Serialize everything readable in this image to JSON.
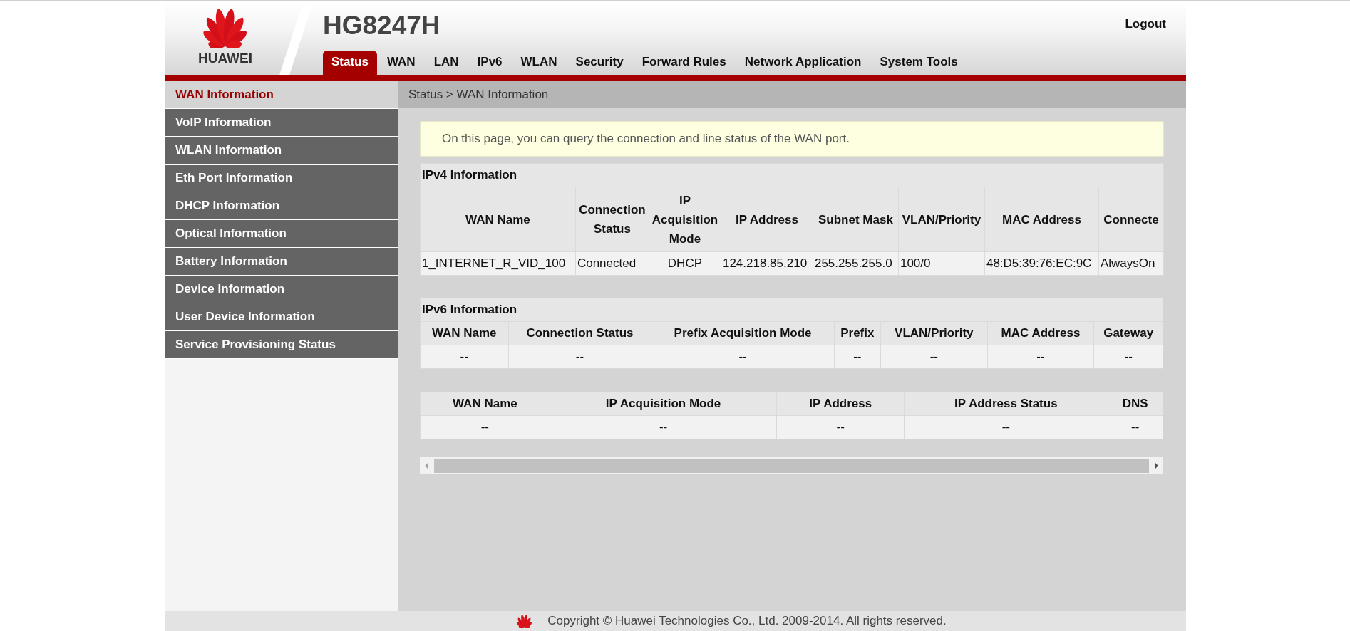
{
  "header": {
    "brand": "HUAWEI",
    "model": "HG8247H",
    "logout": "Logout"
  },
  "tabs": [
    {
      "label": "Status",
      "selected": true
    },
    {
      "label": "WAN",
      "selected": false
    },
    {
      "label": "LAN",
      "selected": false
    },
    {
      "label": "IPv6",
      "selected": false
    },
    {
      "label": "WLAN",
      "selected": false
    },
    {
      "label": "Security",
      "selected": false
    },
    {
      "label": "Forward Rules",
      "selected": false
    },
    {
      "label": "Network Application",
      "selected": false
    },
    {
      "label": "System Tools",
      "selected": false
    }
  ],
  "sidebar": {
    "items": [
      {
        "label": "WAN Information",
        "selected": true
      },
      {
        "label": "VoIP Information",
        "selected": false
      },
      {
        "label": "WLAN Information",
        "selected": false
      },
      {
        "label": "Eth Port Information",
        "selected": false
      },
      {
        "label": "DHCP Information",
        "selected": false
      },
      {
        "label": "Optical Information",
        "selected": false
      },
      {
        "label": "Battery Information",
        "selected": false
      },
      {
        "label": "Device Information",
        "selected": false
      },
      {
        "label": "User Device Information",
        "selected": false
      },
      {
        "label": "Service Provisioning Status",
        "selected": false
      }
    ]
  },
  "breadcrumb": "Status > WAN Information",
  "notice": "On this page, you can query the connection and line status of the WAN port.",
  "tables": [
    {
      "title": "IPv4 Information",
      "columns": [
        "WAN Name",
        "Connection Status",
        "IP Acquisition Mode",
        "IP Address",
        "Subnet Mask",
        "VLAN/Priority",
        "MAC Address",
        "Connecte"
      ],
      "rows": [
        [
          "1_INTERNET_R_VID_100",
          "Connected",
          "DHCP",
          "124.218.85.210",
          "255.255.255.0",
          "100/0",
          "48:D5:39:76:EC:9C",
          "AlwaysOn"
        ]
      ]
    },
    {
      "title": "IPv6 Information",
      "columns": [
        "WAN Name",
        "Connection Status",
        "Prefix Acquisition Mode",
        "Prefix",
        "VLAN/Priority",
        "MAC Address",
        "Gateway"
      ],
      "rows": [
        [
          "--",
          "--",
          "--",
          "--",
          "--",
          "--",
          "--"
        ]
      ]
    },
    {
      "columns": [
        "WAN Name",
        "IP Acquisition Mode",
        "IP Address",
        "IP Address Status",
        "DNS"
      ],
      "rows": [
        [
          "--",
          "--",
          "--",
          "--",
          "--"
        ]
      ]
    }
  ],
  "footer": {
    "copyright": "Copyright © Huawei Technologies Co., Ltd. 2009-2014. All rights reserved."
  }
}
